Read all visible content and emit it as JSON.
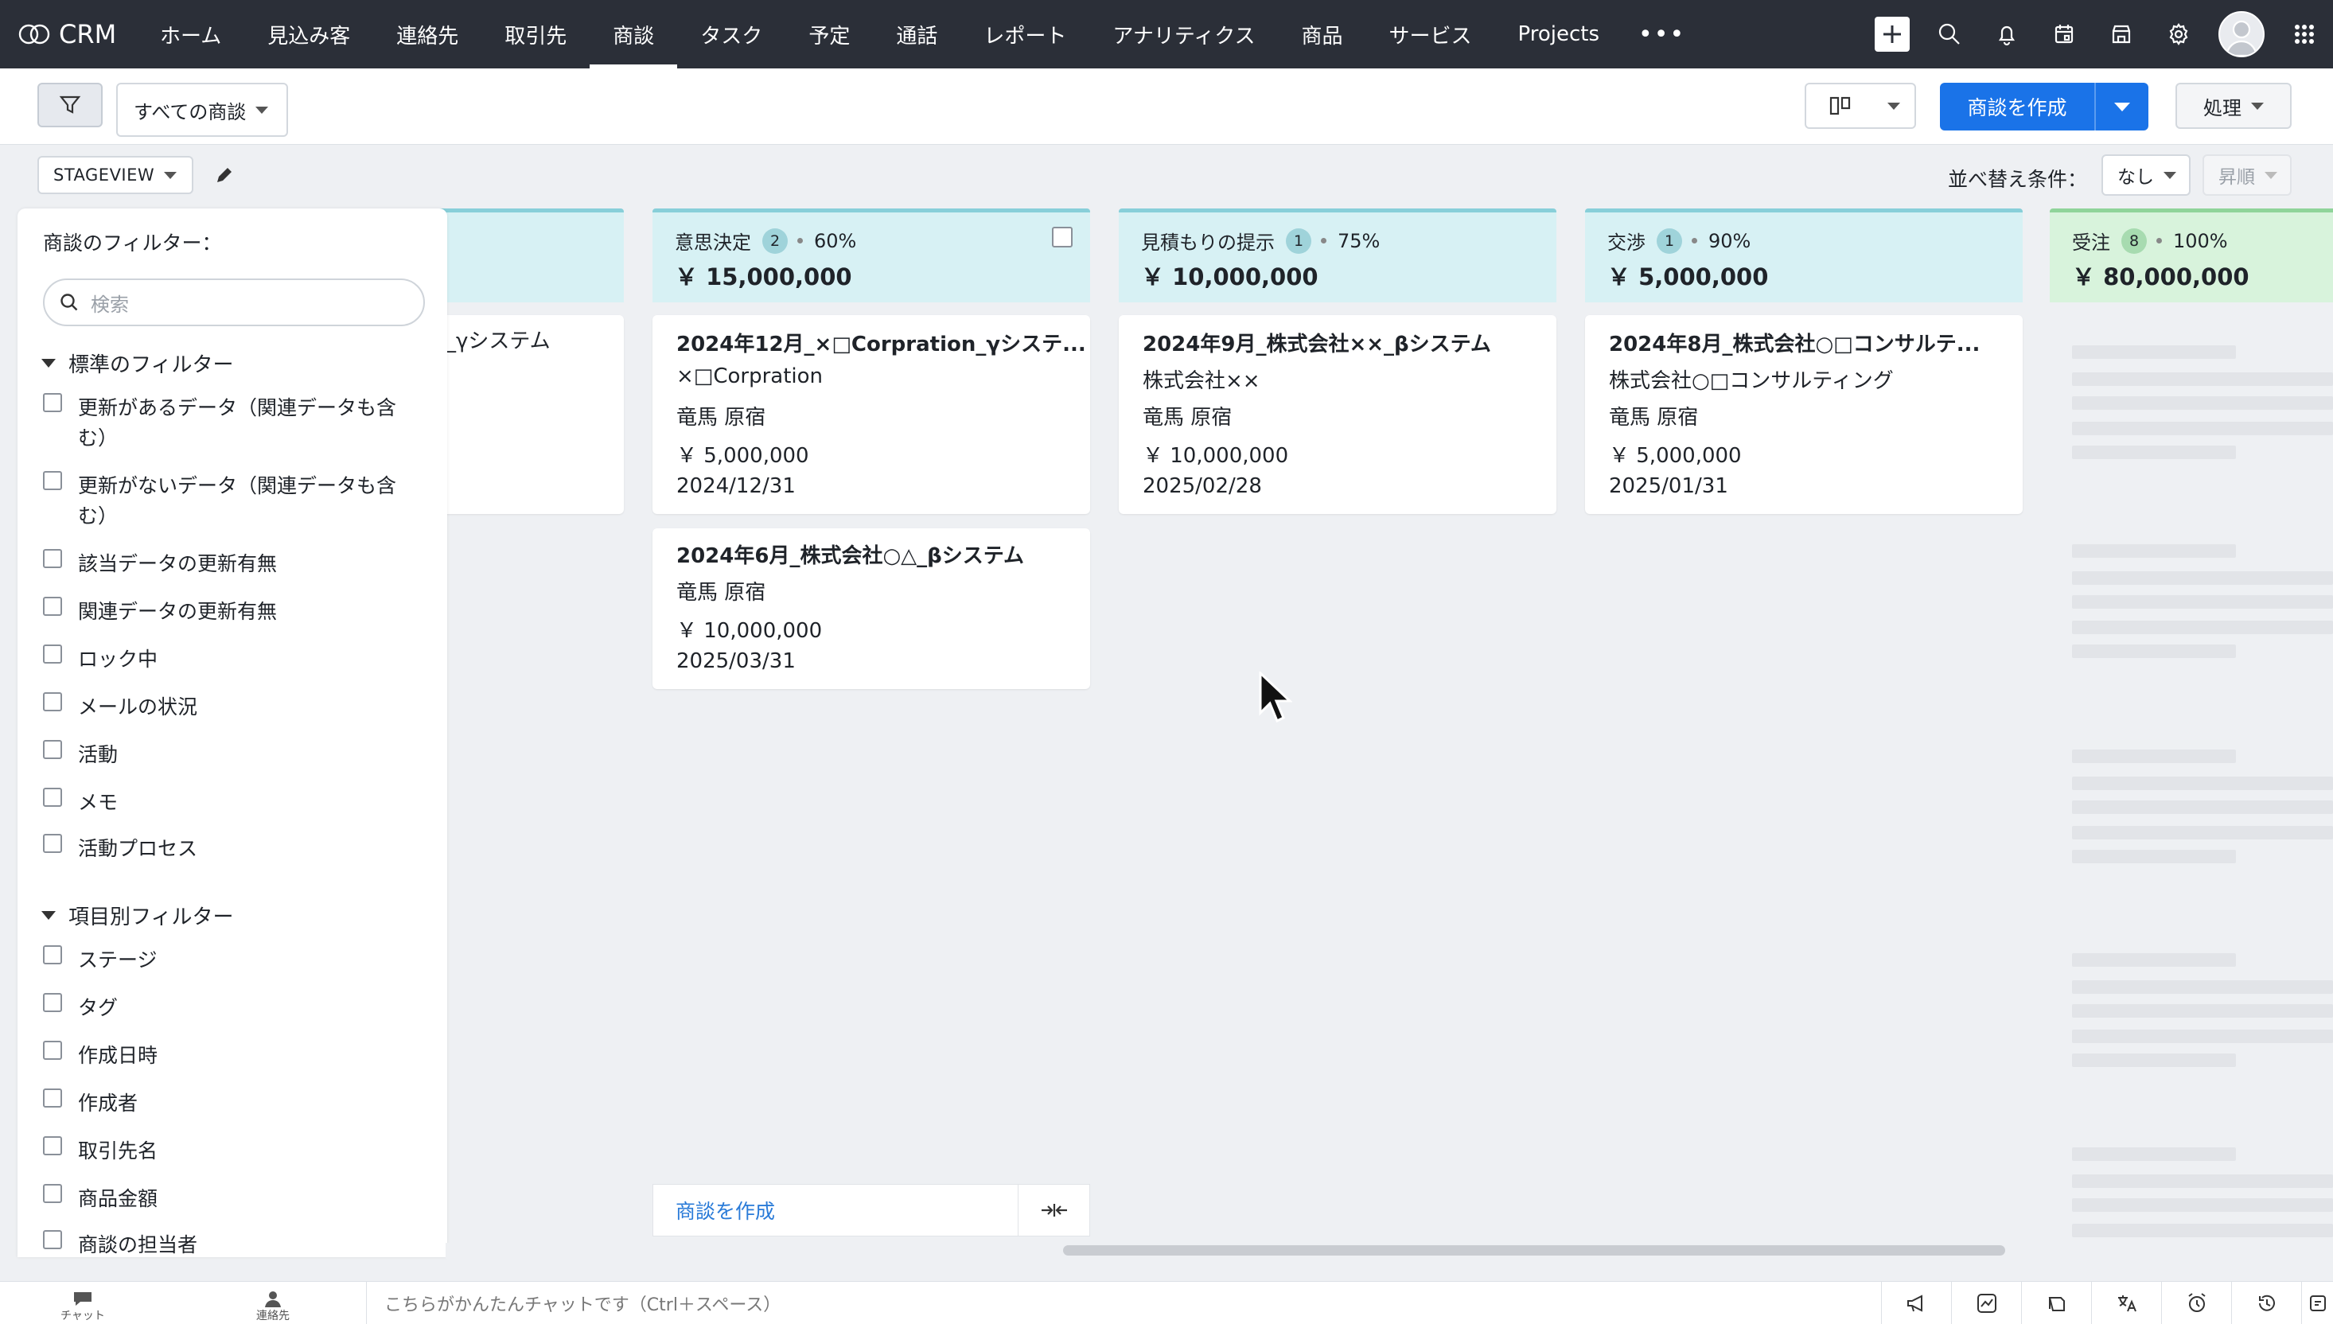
{
  "app": {
    "name": "CRM"
  },
  "nav": {
    "items": [
      {
        "label": "ホーム"
      },
      {
        "label": "見込み客"
      },
      {
        "label": "連絡先"
      },
      {
        "label": "取引先"
      },
      {
        "label": "商談",
        "active": true
      },
      {
        "label": "タスク"
      },
      {
        "label": "予定"
      },
      {
        "label": "通話"
      },
      {
        "label": "レポート"
      },
      {
        "label": "アナリティクス"
      },
      {
        "label": "商品"
      },
      {
        "label": "サービス"
      },
      {
        "label": "Projects"
      }
    ],
    "more": "•••"
  },
  "toolbar": {
    "view_label": "すべての商談",
    "create_label": "商談を作成",
    "action_label": "処理"
  },
  "subbar": {
    "stageview_label": "STAGEVIEW",
    "sort_label": "並べ替え条件：",
    "sort_value": "なし",
    "order_value": "昇順"
  },
  "filter_panel": {
    "title": "商談のフィルター：",
    "search_placeholder": "検索",
    "standard_section": "標準のフィルター",
    "standard_items": [
      "更新があるデータ（関連データも含む）",
      "更新がないデータ（関連データも含む）",
      "該当データの更新有無",
      "関連データの更新有無",
      "ロック中",
      "メールの状況",
      "活動",
      "メモ",
      "活動プロセス"
    ],
    "field_section": "項目別フィルター",
    "field_items": [
      "ステージ",
      "タグ",
      "作成日時",
      "作成者",
      "取引先名",
      "商品金額",
      "商談の担当者"
    ]
  },
  "columns": [
    {
      "name": "意思決定",
      "count": "2",
      "pct": "60%",
      "amount": "￥ 15,000,000",
      "cards": [
        {
          "title": "2024年12月_×□Corpration_γシステ...",
          "account": "×□Corpration",
          "owner": "竜馬 原宿",
          "amount": "￥ 5,000,000",
          "date": "2024/12/31"
        },
        {
          "title": "2024年6月_株式会社○△_βシステム",
          "owner": "竜馬 原宿",
          "amount": "￥ 10,000,000",
          "date": "2025/03/31"
        }
      ]
    },
    {
      "name": "見積もりの提示",
      "count": "1",
      "pct": "75%",
      "amount": "￥ 10,000,000",
      "cards": [
        {
          "title": "2024年9月_株式会社××_βシステム",
          "account": "株式会社××",
          "owner": "竜馬 原宿",
          "amount": "￥ 10,000,000",
          "date": "2025/02/28"
        }
      ]
    },
    {
      "name": "交渉",
      "count": "1",
      "pct": "90%",
      "amount": "￥ 5,000,000",
      "cards": [
        {
          "title": "2024年8月_株式会社○□コンサルテ...",
          "account": "株式会社○□コンサルティング",
          "owner": "竜馬 原宿",
          "amount": "￥ 5,000,000",
          "date": "2025/01/31"
        }
      ]
    },
    {
      "name": "受注",
      "count": "8",
      "pct": "100%",
      "amount": "￥ 80,000,000"
    }
  ],
  "partial_column": {
    "card_title_fragment": "_γシステム"
  },
  "bottom_create": {
    "label": "商談を作成"
  },
  "footer": {
    "chat_label": "チャット",
    "contacts_label": "連絡先",
    "chat_placeholder": "こちらがかんたんチャットです（Ctrl＋スペース）"
  },
  "colors": {
    "topbar": "#2b2f38",
    "primary": "#1a73e8",
    "stage_header": "#d7f1f4",
    "won_header": "#d8f3dc"
  }
}
